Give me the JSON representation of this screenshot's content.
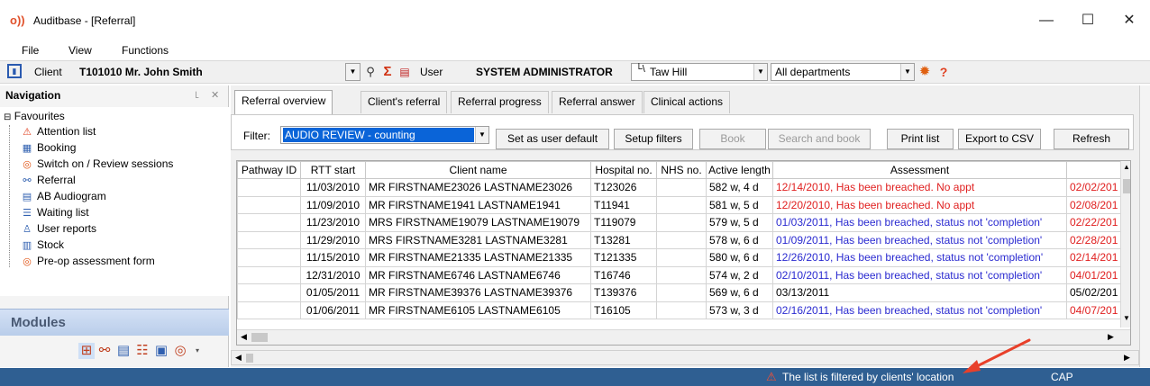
{
  "window": {
    "title": "Auditbase - [Referral]",
    "minimize": "—",
    "maximize": "☐",
    "close": "✕"
  },
  "menu": [
    "File",
    "View",
    "Functions"
  ],
  "client_bar": {
    "client_label": "Client",
    "client_value": "T101010 Mr. John Smith",
    "user_label": "User",
    "user_value": "SYSTEM ADMINISTRATOR",
    "location": "Taw Hill",
    "department": "All departments",
    "help": "?"
  },
  "navigation": {
    "title": "Navigation",
    "pin": "꜖",
    "close": "✕",
    "root": "Favourites",
    "items": [
      {
        "label": "Attention list",
        "icon": "warning-icon"
      },
      {
        "label": "Booking",
        "icon": "calendar-icon"
      },
      {
        "label": "Switch on / Review sessions",
        "icon": "target-icon"
      },
      {
        "label": "Referral",
        "icon": "referral-icon"
      },
      {
        "label": "AB Audiogram",
        "icon": "audiogram-icon"
      },
      {
        "label": "Waiting list",
        "icon": "waiting-list-icon"
      },
      {
        "label": "User reports",
        "icon": "reports-icon"
      },
      {
        "label": "Stock",
        "icon": "stock-icon"
      },
      {
        "label": "Pre-op assessment form",
        "icon": "target-icon"
      }
    ],
    "modules_label": "Modules"
  },
  "tabs": [
    "Referral overview",
    "Client's referral",
    "Referral progress",
    "Referral answer",
    "Clinical actions"
  ],
  "filter": {
    "label": "Filter:",
    "value": "AUDIO REVIEW - counting",
    "buttons": {
      "set_default": "Set as user default",
      "setup": "Setup filters",
      "book": "Book",
      "search_book": "Search and book",
      "print": "Print list",
      "export": "Export to CSV",
      "refresh": "Refresh"
    }
  },
  "table": {
    "columns": [
      "Pathway ID",
      "RTT start",
      "Client name",
      "Hospital no.",
      "NHS no.",
      "Active length",
      "Assessment",
      ""
    ],
    "rows": [
      {
        "pathway": "",
        "rtt": "11/03/2010",
        "name": "MR FIRSTNAME23026 LASTNAME23026",
        "hosp": "T123026",
        "nhs": "",
        "length": "582 w, 4 d",
        "assessment": "12/14/2010, Has been breached. No appt",
        "a_color": "red",
        "next": "02/02/201",
        "n_color": "red"
      },
      {
        "pathway": "",
        "rtt": "11/09/2010",
        "name": "MR FIRSTNAME1941 LASTNAME1941",
        "hosp": "T11941",
        "nhs": "",
        "length": "581 w, 5 d",
        "assessment": "12/20/2010, Has been breached. No appt",
        "a_color": "red",
        "next": "02/08/201",
        "n_color": "red"
      },
      {
        "pathway": "",
        "rtt": "11/23/2010",
        "name": "MRS FIRSTNAME19079 LASTNAME19079",
        "hosp": "T119079",
        "nhs": "",
        "length": "579 w, 5 d",
        "assessment": "01/03/2011, Has been breached, status not 'completion'",
        "a_color": "blue",
        "next": "02/22/201",
        "n_color": "red"
      },
      {
        "pathway": "",
        "rtt": "11/29/2010",
        "name": "MRS FIRSTNAME3281 LASTNAME3281",
        "hosp": "T13281",
        "nhs": "",
        "length": "578 w, 6 d",
        "assessment": "01/09/2011, Has been breached, status not 'completion'",
        "a_color": "blue",
        "next": "02/28/201",
        "n_color": "red"
      },
      {
        "pathway": "",
        "rtt": "11/15/2010",
        "name": "MR FIRSTNAME21335 LASTNAME21335",
        "hosp": "T121335",
        "nhs": "",
        "length": "580 w, 6 d",
        "assessment": "12/26/2010, Has been breached, status not 'completion'",
        "a_color": "blue",
        "next": "02/14/201",
        "n_color": "red"
      },
      {
        "pathway": "",
        "rtt": "12/31/2010",
        "name": "MR FIRSTNAME6746 LASTNAME6746",
        "hosp": "T16746",
        "nhs": "",
        "length": "574 w, 2 d",
        "assessment": "02/10/2011, Has been breached, status not 'completion'",
        "a_color": "blue",
        "next": "04/01/201",
        "n_color": "red"
      },
      {
        "pathway": "",
        "rtt": "01/05/2011",
        "name": "MR FIRSTNAME39376 LASTNAME39376",
        "hosp": "T139376",
        "nhs": "",
        "length": "569 w, 6 d",
        "assessment": "03/13/2011",
        "a_color": "black",
        "next": "05/02/201",
        "n_color": "black"
      },
      {
        "pathway": "",
        "rtt": "01/06/2011",
        "name": "MR FIRSTNAME6105 LASTNAME6105",
        "hosp": "T16105",
        "nhs": "",
        "length": "573 w, 3 d",
        "assessment": "02/16/2011, Has been breached, status not 'completion'",
        "a_color": "blue",
        "next": "04/07/201",
        "n_color": "red"
      }
    ]
  },
  "status": {
    "message": "The list is filtered by clients' location",
    "cap": "CAP"
  },
  "colors": {
    "status_bar": "#2f5f92",
    "breach_red": "#e02020",
    "status_blue": "#2a2ad0",
    "selection": "#0a64d8",
    "annotation_arrow": "#e8402a"
  }
}
